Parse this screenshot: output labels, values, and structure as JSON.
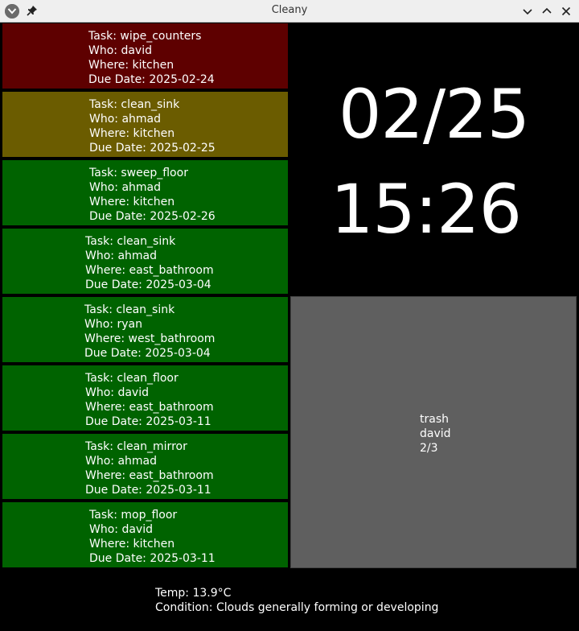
{
  "window": {
    "title": "Cleany",
    "icons": {
      "app": "kde-app-icon",
      "pin": "pin-icon",
      "minimize": "chevron-down-icon",
      "maximize": "chevron-up-icon",
      "close": "close-icon"
    }
  },
  "colors": {
    "overdue": "#5e0000",
    "due_today": "#6b5c00",
    "upcoming": "#006300",
    "chore_panel": "#5f5f5f"
  },
  "tasks": [
    {
      "status": "overdue",
      "task": "Task: wipe_counters",
      "who": "Who: david",
      "where": "Where: kitchen",
      "due": "Due Date: 2025-02-24"
    },
    {
      "status": "due-today",
      "task": "Task: clean_sink",
      "who": "Who: ahmad",
      "where": "Where: kitchen",
      "due": "Due Date: 2025-02-25"
    },
    {
      "status": "upcoming",
      "task": "Task: sweep_floor",
      "who": "Who: ahmad",
      "where": "Where: kitchen",
      "due": "Due Date: 2025-02-26"
    },
    {
      "status": "upcoming",
      "task": "Task: clean_sink",
      "who": "Who: ahmad",
      "where": "Where: east_bathroom",
      "due": "Due Date: 2025-03-04"
    },
    {
      "status": "upcoming",
      "task": "Task: clean_sink",
      "who": "Who: ryan",
      "where": "Where: west_bathroom",
      "due": "Due Date: 2025-03-04"
    },
    {
      "status": "upcoming",
      "task": "Task: clean_floor",
      "who": "Who: david",
      "where": "Where: east_bathroom",
      "due": "Due Date: 2025-03-11"
    },
    {
      "status": "upcoming",
      "task": "Task: clean_mirror",
      "who": "Who: ahmad",
      "where": "Where: east_bathroom",
      "due": "Due Date: 2025-03-11"
    },
    {
      "status": "upcoming",
      "task": "Task: mop_floor",
      "who": "Who: david",
      "where": "Where: kitchen",
      "due": "Due Date: 2025-03-11"
    }
  ],
  "clock": {
    "date": "02/25",
    "time": "15:26"
  },
  "chore": {
    "name": "trash",
    "person": "david",
    "progress": "2/3"
  },
  "weather": {
    "temp": "Temp: 13.9°C",
    "condition": "Condition: Clouds generally forming or developing"
  }
}
